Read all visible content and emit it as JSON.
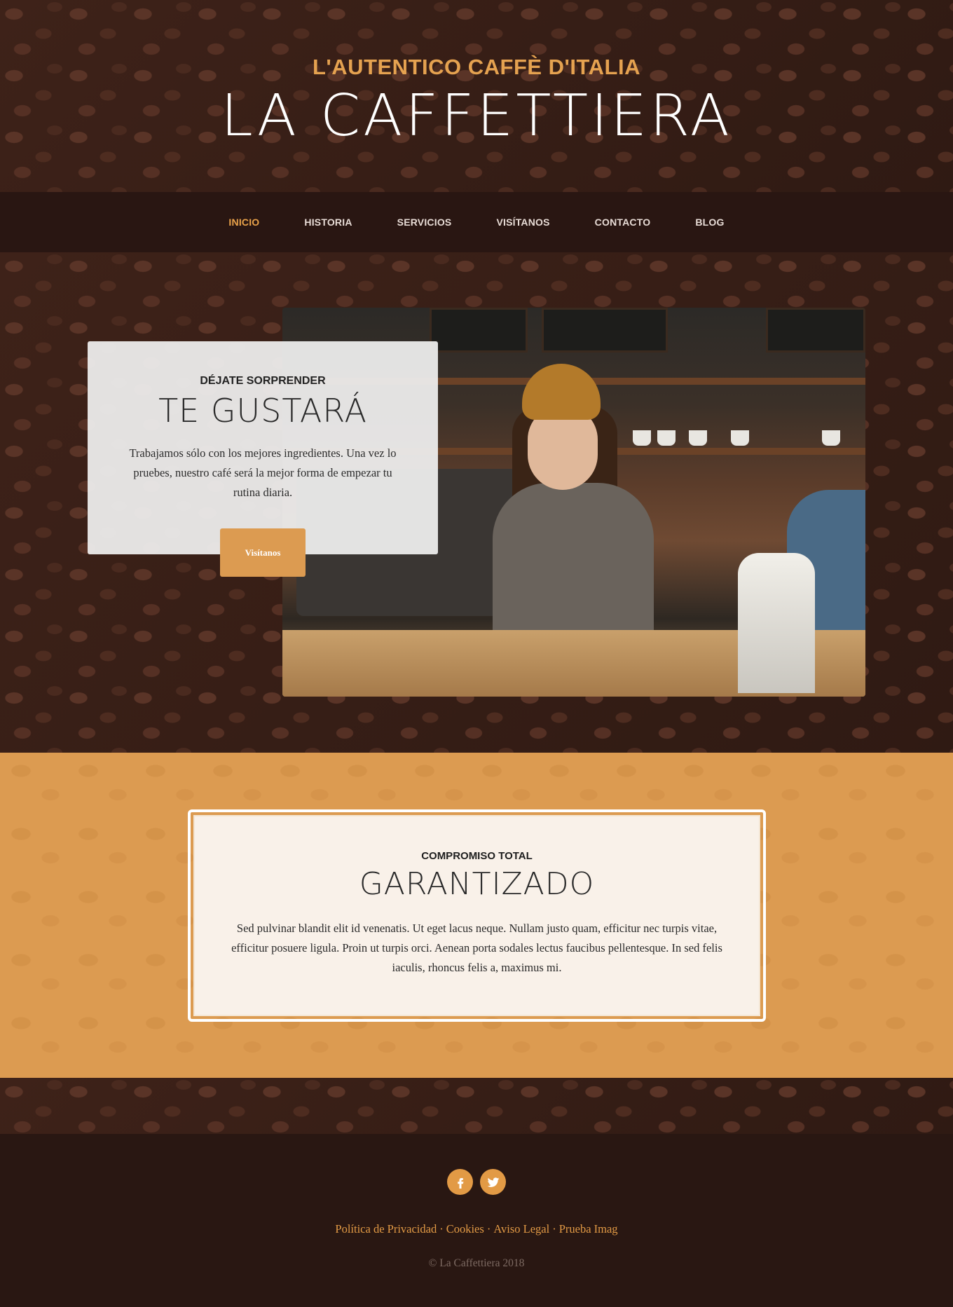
{
  "header": {
    "tagline": "L'AUTENTICO CAFFÈ D'ITALIA",
    "title": "LA CAFFETTIERA"
  },
  "nav": {
    "items": [
      {
        "label": "INICIO",
        "active": true
      },
      {
        "label": "HISTORIA",
        "active": false
      },
      {
        "label": "SERVICIOS",
        "active": false
      },
      {
        "label": "VISÍTANOS",
        "active": false
      },
      {
        "label": "CONTACTO",
        "active": false
      },
      {
        "label": "BLOG",
        "active": false
      }
    ]
  },
  "hero": {
    "kicker": "DÉJATE SORPRENDER",
    "heading": "TE GUSTARÁ",
    "text": "Trabajamos sólo con los mejores ingredientes. Una vez lo pruebes, nuestro café será la mejor forma de empezar tu rutina diaria.",
    "button_label": "Visítanos"
  },
  "commitment": {
    "kicker": "COMPROMISO TOTAL",
    "heading": "GARANTIZADO",
    "text": "Sed pulvinar blandit elit id venenatis. Ut eget lacus neque. Nullam justo quam, efficitur nec turpis vitae, efficitur posuere ligula. Proin ut turpis orci. Aenean porta sodales lectus faucibus pellentesque. In sed felis iaculis, rhoncus felis a, maximus mi."
  },
  "footer": {
    "social": [
      {
        "icon": "facebook-icon"
      },
      {
        "icon": "twitter-icon"
      }
    ],
    "links": [
      "Política de Privacidad",
      "Cookies",
      "Aviso Legal",
      "Prueba Imag"
    ],
    "separator": "·",
    "copyright": "© La Caffettiera 2018"
  },
  "colors": {
    "accent": "#dc9b51",
    "dark": "#2b1813",
    "nav_active": "#e9a24a"
  }
}
